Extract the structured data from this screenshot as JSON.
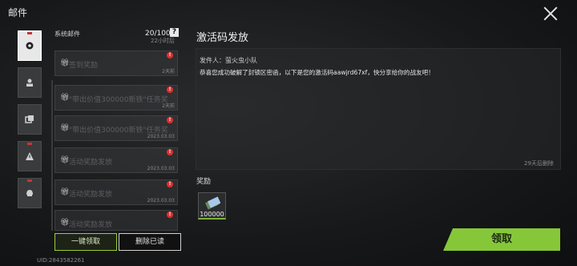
{
  "window": {
    "title": "邮件"
  },
  "categories": [
    {
      "icon": "gear-icon",
      "active": true
    },
    {
      "icon": "person-icon",
      "active": false
    },
    {
      "icon": "box-icon",
      "active": false
    },
    {
      "icon": "warning-icon",
      "active": false
    },
    {
      "icon": "helmet-icon",
      "active": false
    }
  ],
  "list": {
    "header": "系统邮件",
    "count": "20/100",
    "help": "?",
    "top_expire": "22小时后",
    "mails": [
      {
        "name": "签到奖励",
        "time": "2天前"
      },
      {
        "name": "\"带出价值300000新铁\"任务奖",
        "time": "2天前"
      },
      {
        "name": "\"带出价值300000新铁\"任务奖",
        "time": "2023.03.03"
      },
      {
        "name": "活动奖励发放",
        "time": "2023.03.03"
      },
      {
        "name": "活动奖励发放",
        "time": "2023.03.03"
      },
      {
        "name": "活动奖励发放",
        "time": ""
      }
    ],
    "claim_all": "一键领取",
    "delete_read": "删除已读",
    "uid": "UID:2843582261"
  },
  "detail": {
    "title": "激活码发放",
    "sender": "发件人：萤火虫小队",
    "body": "恭喜您成功破解了封锁区密函，以下是您的激活码aawjrd67xf，快分享给你的战友吧！",
    "delete_after": "29天后删除",
    "reward_label": "奖励",
    "reward_amount": "100000",
    "claim": "领取"
  },
  "colors": {
    "accent": "#86c73a",
    "badge": "#e03030"
  }
}
